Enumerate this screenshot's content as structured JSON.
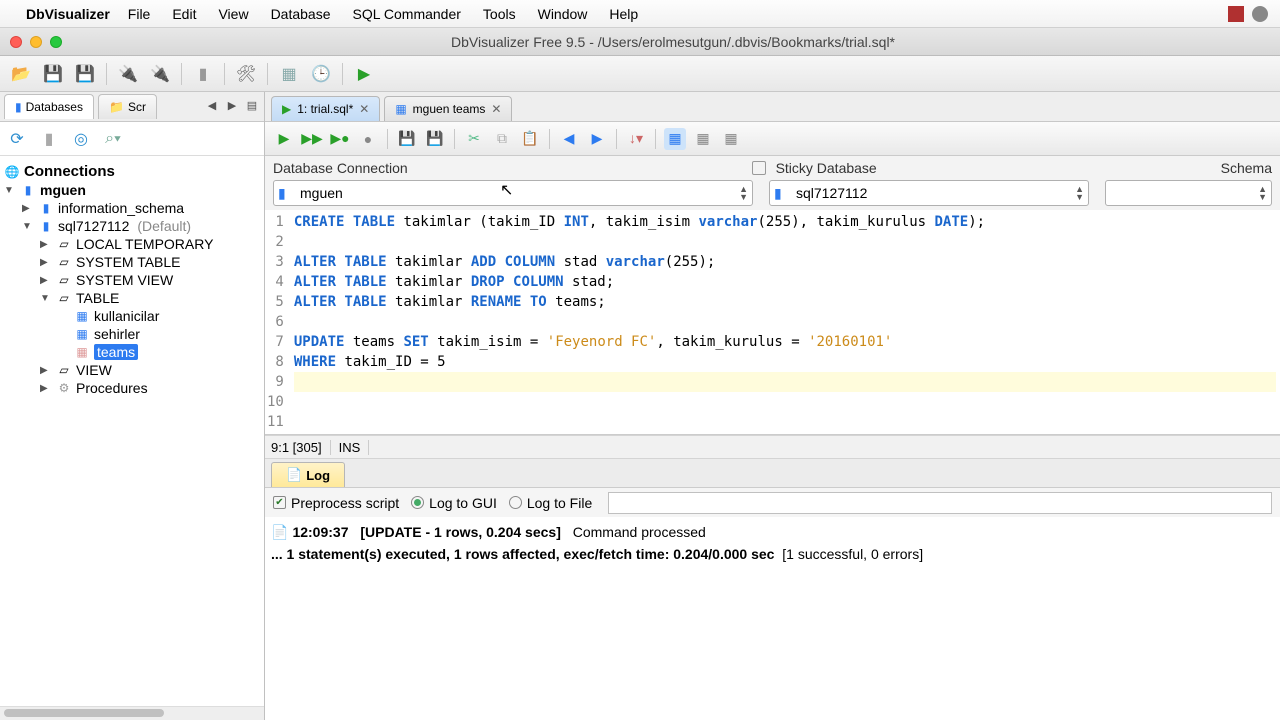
{
  "menubar": {
    "app": "DbVisualizer",
    "items": [
      "File",
      "Edit",
      "View",
      "Database",
      "SQL Commander",
      "Tools",
      "Window",
      "Help"
    ]
  },
  "window": {
    "title": "DbVisualizer Free 9.5 - /Users/erolmesutgun/.dbvis/Bookmarks/trial.sql*"
  },
  "sidebar": {
    "tabs": {
      "databases": "Databases",
      "scripts": "Scr"
    },
    "header": "Connections",
    "tree": {
      "conn": "mguen",
      "schemas": [
        {
          "name": "information_schema"
        },
        {
          "name": "sql7127112",
          "suffix": "(Default)"
        }
      ],
      "catnodes": [
        "LOCAL TEMPORARY",
        "SYSTEM TABLE",
        "SYSTEM VIEW",
        "TABLE",
        "VIEW",
        "Procedures"
      ],
      "tables": [
        "kullanicilar",
        "sehirler",
        "teams"
      ]
    }
  },
  "filetabs": [
    {
      "label": "1: trial.sql*"
    },
    {
      "label": "mguen teams"
    }
  ],
  "connrow": {
    "dbconn_label": "Database Connection",
    "sticky_label": "Sticky Database",
    "schema_label": "Schema",
    "conn_value": "mguen",
    "db_value": "sql7127112"
  },
  "editor": {
    "lines": [
      {
        "n": 1,
        "seg": [
          [
            "kw",
            "CREATE TABLE"
          ],
          [
            "",
            " takimlar (takim_ID "
          ],
          [
            "ty",
            "INT"
          ],
          [
            "",
            ", takim_isim "
          ],
          [
            "kw",
            "varchar"
          ],
          [
            "",
            "(255), takim_kurulus "
          ],
          [
            "ty",
            "DATE"
          ],
          [
            "",
            ");"
          ]
        ]
      },
      {
        "n": 2,
        "seg": []
      },
      {
        "n": 3,
        "seg": [
          [
            "kw",
            "ALTER TABLE"
          ],
          [
            "",
            " takimlar "
          ],
          [
            "kw",
            "ADD COLUMN"
          ],
          [
            "",
            " stad "
          ],
          [
            "kw",
            "varchar"
          ],
          [
            "",
            "(255);"
          ]
        ]
      },
      {
        "n": 4,
        "seg": [
          [
            "kw",
            "ALTER TABLE"
          ],
          [
            "",
            " takimlar "
          ],
          [
            "kw",
            "DROP COLUMN"
          ],
          [
            "",
            " stad;"
          ]
        ]
      },
      {
        "n": 5,
        "seg": [
          [
            "kw",
            "ALTER TABLE"
          ],
          [
            "",
            " takimlar "
          ],
          [
            "kw",
            "RENAME TO"
          ],
          [
            "",
            " teams;"
          ]
        ]
      },
      {
        "n": 6,
        "seg": []
      },
      {
        "n": 7,
        "seg": [
          [
            "kw",
            "UPDATE"
          ],
          [
            "",
            " teams "
          ],
          [
            "kw",
            "SET"
          ],
          [
            "",
            " takim_isim = "
          ],
          [
            "st",
            "'Feyenord FC'"
          ],
          [
            "",
            ", takim_kurulus = "
          ],
          [
            "st",
            "'20160101'"
          ]
        ]
      },
      {
        "n": 8,
        "seg": [
          [
            "kw",
            "WHERE"
          ],
          [
            "",
            " takim_ID = 5"
          ]
        ]
      },
      {
        "n": 9,
        "seg": [],
        "hl": true
      },
      {
        "n": 10,
        "seg": []
      },
      {
        "n": 11,
        "seg": []
      }
    ],
    "status": {
      "pos": "9:1 [305]",
      "mode": "INS"
    }
  },
  "log": {
    "tab": "Log",
    "preprocess": "Preprocess script",
    "loggui": "Log to GUI",
    "logfile": "Log to File",
    "line1_time": "12:09:37",
    "line1_head": "[UPDATE - 1 rows, 0.204 secs]",
    "line1_tail": "Command processed",
    "line2_bold": "... 1 statement(s) executed, 1 rows affected, exec/fetch time: 0.204/0.000 sec",
    "line2_tail": "[1 successful, 0 errors]"
  }
}
